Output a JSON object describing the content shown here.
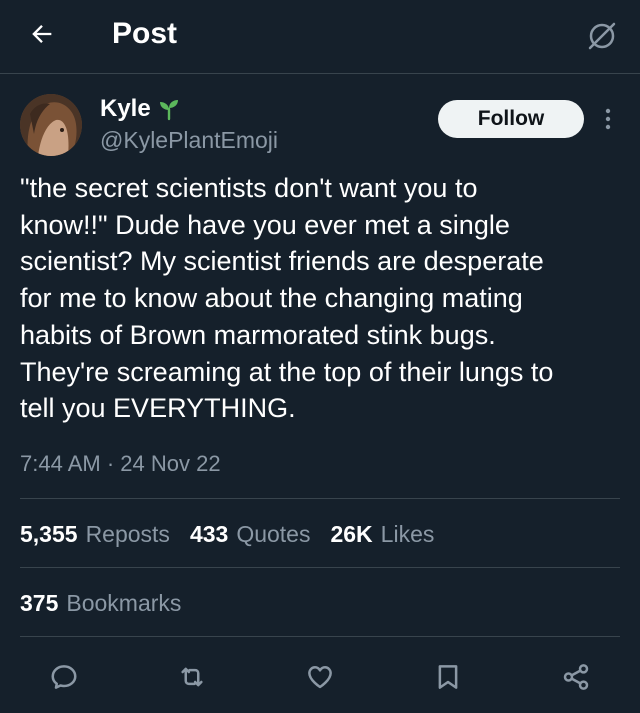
{
  "header": {
    "title": "Post",
    "back_icon": "arrow-left-icon",
    "grok_icon": "grok-slash-icon"
  },
  "author": {
    "name": "Kyle",
    "handle": "@KylePlantEmoji",
    "badge_icon": "sprout-emoji-icon"
  },
  "follow_label": "Follow",
  "tweet": {
    "text": "\"the secret scientists don't want you to\nknow!!\" Dude have you ever met a single\nscientist? My scientist friends are desperate\nfor me to know about the changing mating\nhabits of Brown marmorated stink bugs.\nThey're screaming at the top of their lungs to\ntell you EVERYTHING.",
    "time": "7:44 AM",
    "separator": "·",
    "date": "24 Nov 22"
  },
  "stats": {
    "reposts": {
      "count": "5,355",
      "label": "Reposts"
    },
    "quotes": {
      "count": "433",
      "label": "Quotes"
    },
    "likes": {
      "count": "26K",
      "label": "Likes"
    },
    "bookmarks": {
      "count": "375",
      "label": "Bookmarks"
    }
  },
  "actions": [
    "reply-icon",
    "repost-icon",
    "like-icon",
    "bookmark-icon",
    "share-icon"
  ],
  "colors": {
    "background": "#15202b",
    "divider": "#38444d",
    "secondary_text": "#8b98a5",
    "follow_bg": "#eff3f4",
    "sprout_green": "#5cb85c"
  }
}
